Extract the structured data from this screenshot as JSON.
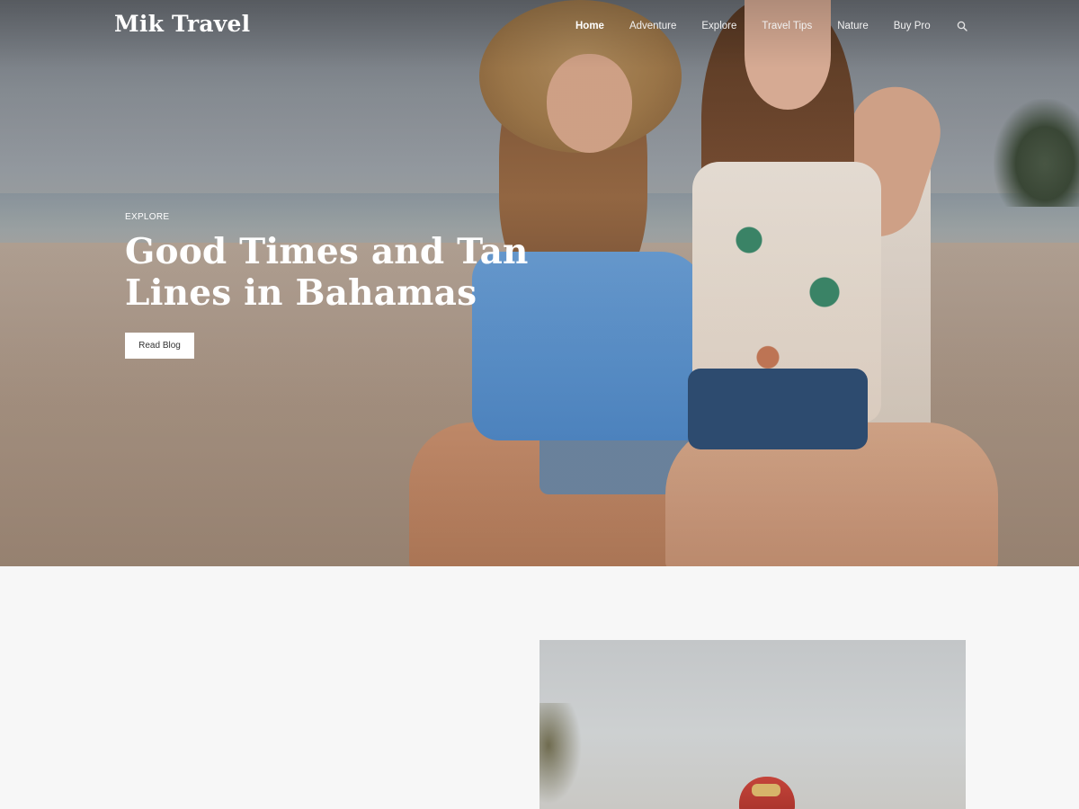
{
  "site": {
    "logo": "Mik Travel"
  },
  "nav": {
    "items": [
      {
        "label": "Home",
        "active": true
      },
      {
        "label": "Adventure",
        "active": false
      },
      {
        "label": "Explore",
        "active": false
      },
      {
        "label": "Travel Tips",
        "active": false
      },
      {
        "label": "Nature",
        "active": false
      },
      {
        "label": "Buy Pro",
        "active": false
      }
    ],
    "search_icon": "search-icon"
  },
  "hero": {
    "kicker": "EXPLORE",
    "title": "Good Times and Tan Lines in Bahamas",
    "button_label": "Read Blog"
  },
  "colors": {
    "hero_text": "#ffffff",
    "button_bg": "#ffffff",
    "page_bg": "#f7f7f7"
  }
}
